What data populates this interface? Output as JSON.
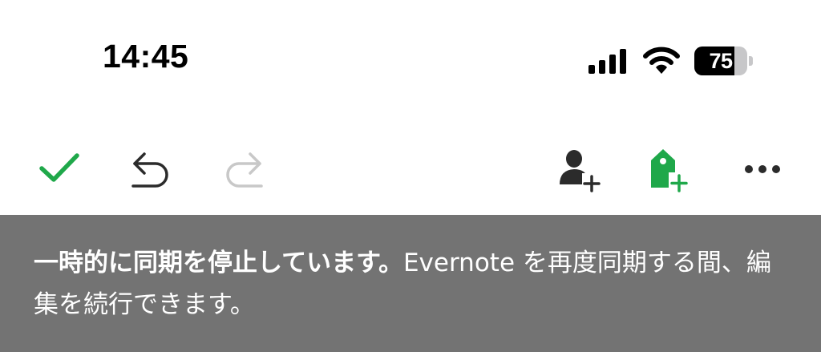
{
  "status_bar": {
    "time": "14:45",
    "battery_level": "75",
    "battery_fraction": 0.75,
    "signal_icon": "cellular-signal-icon",
    "wifi_icon": "wifi-icon"
  },
  "toolbar": {
    "done_icon": "checkmark-icon",
    "undo_icon": "undo-icon",
    "redo_icon": "redo-icon",
    "share_icon": "add-person-icon",
    "tag_icon": "add-tag-icon",
    "more_icon": "more-horizontal-icon"
  },
  "banner": {
    "title": "一時的に同期を停止しています。",
    "message": "Evernote を再度同期する間、編集を続行できます。"
  },
  "colors": {
    "accent_green": "#1fa84a",
    "banner_bg": "#737373",
    "disabled_gray": "#c8c8c8"
  }
}
